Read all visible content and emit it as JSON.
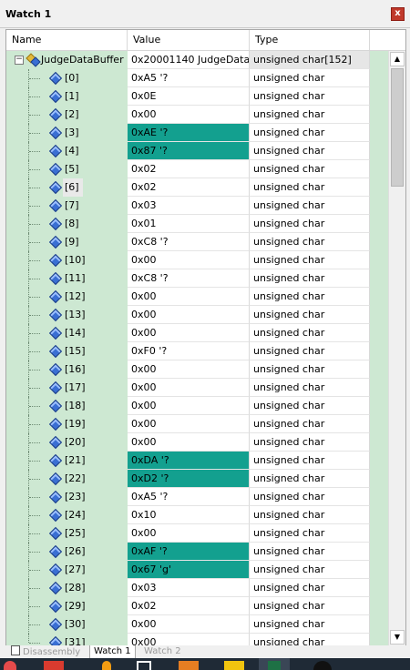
{
  "window": {
    "title": "Watch 1",
    "close_glyph": "x"
  },
  "columns": {
    "name": "Name",
    "value": "Value",
    "type": "Type"
  },
  "root": {
    "name": "JudgeDataBuffer",
    "value": "0x20001140 JudgeData...",
    "type": "unsigned char[152]",
    "expander": "−",
    "icon": "struct-icon"
  },
  "elements": [
    {
      "name": "[0]",
      "value": "0xA5 '?",
      "type": "unsigned char",
      "highlight": false
    },
    {
      "name": "[1]",
      "value": "0x0E",
      "type": "unsigned char",
      "highlight": false
    },
    {
      "name": "[2]",
      "value": "0x00",
      "type": "unsigned char",
      "highlight": false
    },
    {
      "name": "[3]",
      "value": "0xAE '?",
      "type": "unsigned char",
      "highlight": true
    },
    {
      "name": "[4]",
      "value": "0x87 '?",
      "type": "unsigned char",
      "highlight": true
    },
    {
      "name": "[5]",
      "value": "0x02",
      "type": "unsigned char",
      "highlight": false
    },
    {
      "name": "[6]",
      "value": "0x02",
      "type": "unsigned char",
      "highlight": false,
      "selected": true
    },
    {
      "name": "[7]",
      "value": "0x03",
      "type": "unsigned char",
      "highlight": false
    },
    {
      "name": "[8]",
      "value": "0x01",
      "type": "unsigned char",
      "highlight": false
    },
    {
      "name": "[9]",
      "value": "0xC8 '?",
      "type": "unsigned char",
      "highlight": false
    },
    {
      "name": "[10]",
      "value": "0x00",
      "type": "unsigned char",
      "highlight": false
    },
    {
      "name": "[11]",
      "value": "0xC8 '?",
      "type": "unsigned char",
      "highlight": false
    },
    {
      "name": "[12]",
      "value": "0x00",
      "type": "unsigned char",
      "highlight": false
    },
    {
      "name": "[13]",
      "value": "0x00",
      "type": "unsigned char",
      "highlight": false
    },
    {
      "name": "[14]",
      "value": "0x00",
      "type": "unsigned char",
      "highlight": false
    },
    {
      "name": "[15]",
      "value": "0xF0 '?",
      "type": "unsigned char",
      "highlight": false
    },
    {
      "name": "[16]",
      "value": "0x00",
      "type": "unsigned char",
      "highlight": false
    },
    {
      "name": "[17]",
      "value": "0x00",
      "type": "unsigned char",
      "highlight": false
    },
    {
      "name": "[18]",
      "value": "0x00",
      "type": "unsigned char",
      "highlight": false
    },
    {
      "name": "[19]",
      "value": "0x00",
      "type": "unsigned char",
      "highlight": false
    },
    {
      "name": "[20]",
      "value": "0x00",
      "type": "unsigned char",
      "highlight": false
    },
    {
      "name": "[21]",
      "value": "0xDA '?",
      "type": "unsigned char",
      "highlight": true
    },
    {
      "name": "[22]",
      "value": "0xD2 '?",
      "type": "unsigned char",
      "highlight": true
    },
    {
      "name": "[23]",
      "value": "0xA5 '?",
      "type": "unsigned char",
      "highlight": false
    },
    {
      "name": "[24]",
      "value": "0x10",
      "type": "unsigned char",
      "highlight": false
    },
    {
      "name": "[25]",
      "value": "0x00",
      "type": "unsigned char",
      "highlight": false
    },
    {
      "name": "[26]",
      "value": "0xAF '?",
      "type": "unsigned char",
      "highlight": true
    },
    {
      "name": "[27]",
      "value": "0x67 'g'",
      "type": "unsigned char",
      "highlight": true
    },
    {
      "name": "[28]",
      "value": "0x03",
      "type": "unsigned char",
      "highlight": false
    },
    {
      "name": "[29]",
      "value": "0x02",
      "type": "unsigned char",
      "highlight": false
    },
    {
      "name": "[30]",
      "value": "0x00",
      "type": "unsigned char",
      "highlight": false
    },
    {
      "name": "[31]",
      "value": "0x00",
      "type": "unsigned char",
      "highlight": false
    }
  ],
  "scrollbar": {
    "up_glyph": "▲",
    "down_glyph": "▼"
  },
  "tabs": [
    {
      "label": "Disassembly",
      "active": false
    },
    {
      "label": "Watch 1",
      "active": true
    },
    {
      "label": "Watch 2",
      "active": false
    }
  ],
  "colors": {
    "changed_value_bg": "#13a08f",
    "name_column_bg": "#cde8d2",
    "variable_icon": "#3a6fd3"
  },
  "taskbar_icons": [
    "red-app-icon",
    "notification-icon",
    "flame-icon",
    "window-icon",
    "orange-app-icon",
    "folder-icon",
    "excel-icon",
    "dark-circle-icon"
  ]
}
